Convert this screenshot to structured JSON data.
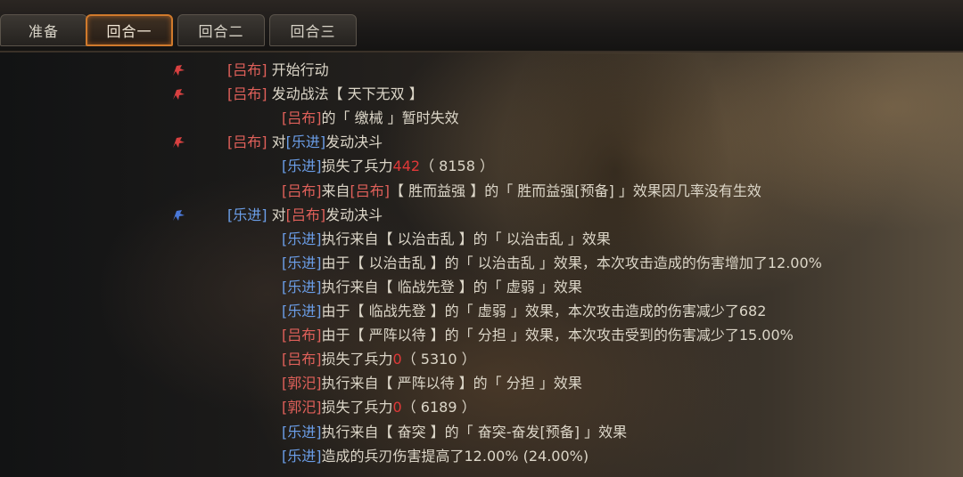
{
  "tabs": [
    {
      "label": "准备",
      "active": false
    },
    {
      "label": "回合一",
      "active": true
    },
    {
      "label": "回合二",
      "active": false
    },
    {
      "label": "回合三",
      "active": false
    }
  ],
  "colors": {
    "red_side": "#e0605a",
    "blue_side": "#6b9ee8",
    "loss_number": "#e03838",
    "active_tab_border": "#d07a2c"
  },
  "icons": {
    "red_flag": "red-army-flag-icon",
    "blue_flag": "blue-army-flag-icon"
  },
  "log": [
    {
      "indent": 0,
      "flag": "red",
      "parts": [
        {
          "t": "[吕布]",
          "c": "red"
        },
        {
          "t": " 开始行动"
        }
      ]
    },
    {
      "indent": 0,
      "flag": "red",
      "parts": [
        {
          "t": "[吕布]",
          "c": "red"
        },
        {
          "t": " 发动战法【 天下无双 】"
        }
      ]
    },
    {
      "indent": 1,
      "flag": null,
      "parts": [
        {
          "t": "[吕布]",
          "c": "red"
        },
        {
          "t": "的「 缴械 」暂时失效"
        }
      ]
    },
    {
      "indent": 0,
      "flag": "red",
      "parts": [
        {
          "t": "[吕布]",
          "c": "red"
        },
        {
          "t": " 对"
        },
        {
          "t": "[乐进]",
          "c": "blue"
        },
        {
          "t": "发动决斗"
        }
      ]
    },
    {
      "indent": 1,
      "flag": null,
      "parts": [
        {
          "t": "[乐进]",
          "c": "blue"
        },
        {
          "t": "损失了兵力"
        },
        {
          "t": "442",
          "c": "num"
        },
        {
          "t": "（ 8158 ）"
        }
      ]
    },
    {
      "indent": 1,
      "flag": null,
      "parts": [
        {
          "t": "[吕布]",
          "c": "red"
        },
        {
          "t": "来自"
        },
        {
          "t": "[吕布]",
          "c": "red"
        },
        {
          "t": "【 胜而益强 】的「 胜而益强[预备] 」效果因几率没有生效"
        }
      ]
    },
    {
      "indent": 0,
      "flag": "blue",
      "parts": [
        {
          "t": "[乐进]",
          "c": "blue"
        },
        {
          "t": " 对"
        },
        {
          "t": "[吕布]",
          "c": "red"
        },
        {
          "t": "发动决斗"
        }
      ]
    },
    {
      "indent": 1,
      "flag": null,
      "parts": [
        {
          "t": "[乐进]",
          "c": "blue"
        },
        {
          "t": "执行来自【 以治击乱 】的「 以治击乱 」效果"
        }
      ]
    },
    {
      "indent": 1,
      "flag": null,
      "parts": [
        {
          "t": "[乐进]",
          "c": "blue"
        },
        {
          "t": "由于【 以治击乱 】的「 以治击乱 」效果，本次攻击造成的伤害增加了12.00%"
        }
      ]
    },
    {
      "indent": 1,
      "flag": null,
      "parts": [
        {
          "t": "[乐进]",
          "c": "blue"
        },
        {
          "t": "执行来自【 临战先登 】的「 虚弱 」效果"
        }
      ]
    },
    {
      "indent": 1,
      "flag": null,
      "parts": [
        {
          "t": "[乐进]",
          "c": "blue"
        },
        {
          "t": "由于【 临战先登 】的「 虚弱 」效果，本次攻击造成的伤害减少了682"
        }
      ]
    },
    {
      "indent": 1,
      "flag": null,
      "parts": [
        {
          "t": "[吕布]",
          "c": "red"
        },
        {
          "t": "由于【 严阵以待 】的「 分担 」效果，本次攻击受到的伤害减少了15.00%"
        }
      ]
    },
    {
      "indent": 1,
      "flag": null,
      "parts": [
        {
          "t": "[吕布]",
          "c": "red"
        },
        {
          "t": "损失了兵力"
        },
        {
          "t": "0",
          "c": "num"
        },
        {
          "t": "（ 5310 ）"
        }
      ]
    },
    {
      "indent": 1,
      "flag": null,
      "parts": [
        {
          "t": "[郭汜]",
          "c": "red"
        },
        {
          "t": "执行来自【 严阵以待 】的「 分担 」效果"
        }
      ]
    },
    {
      "indent": 1,
      "flag": null,
      "parts": [
        {
          "t": "[郭汜]",
          "c": "red"
        },
        {
          "t": "损失了兵力"
        },
        {
          "t": "0",
          "c": "num"
        },
        {
          "t": "（ 6189 ）"
        }
      ]
    },
    {
      "indent": 1,
      "flag": null,
      "parts": [
        {
          "t": "[乐进]",
          "c": "blue"
        },
        {
          "t": "执行来自【 奋突 】的「 奋突-奋发[预备] 」效果"
        }
      ]
    },
    {
      "indent": 1,
      "flag": null,
      "parts": [
        {
          "t": "[乐进]",
          "c": "blue"
        },
        {
          "t": "造成的兵刃伤害提高了12.00% (24.00%)"
        }
      ]
    }
  ]
}
